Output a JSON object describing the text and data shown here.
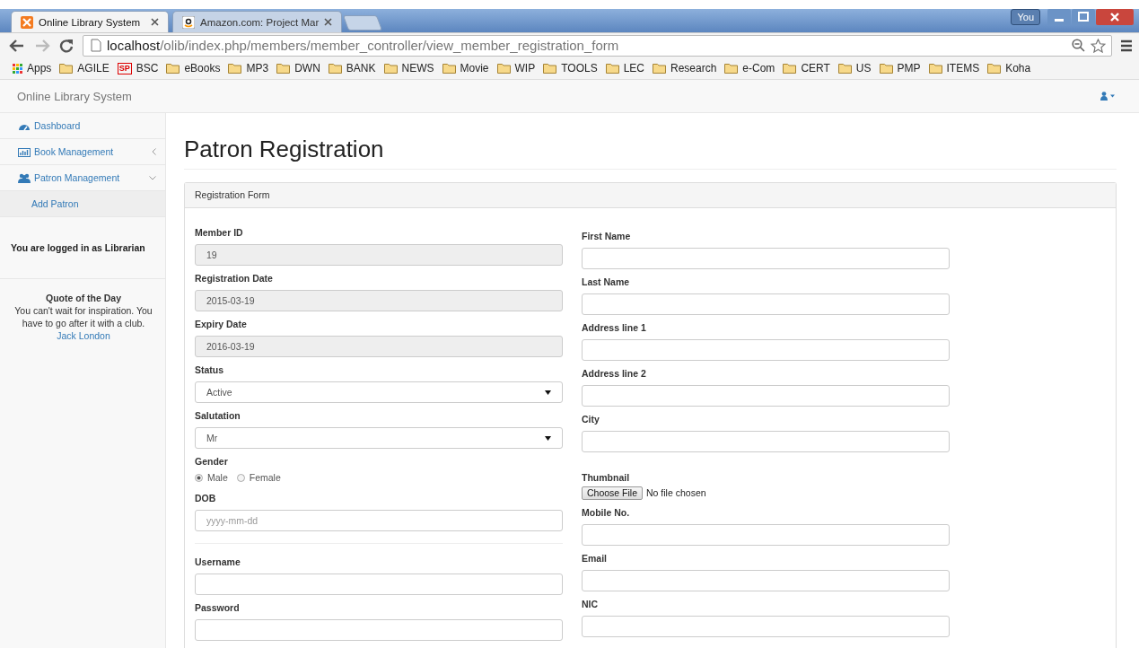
{
  "browser": {
    "tabs": [
      {
        "title": "Online Library System",
        "kind": "app",
        "selected": true
      },
      {
        "title": "Amazon.com: Project Mar",
        "kind": "shop",
        "selected": false
      }
    ],
    "user_badge": "You",
    "address": {
      "host": "localhost",
      "path": "/olib/index.php/members/member_controller/view_member_registration_form"
    },
    "bookmarks": [
      {
        "label": "Apps",
        "kind": "apps"
      },
      {
        "label": "AGILE",
        "kind": "folder"
      },
      {
        "label": "BSC",
        "kind": "sp",
        "badge": "SP"
      },
      {
        "label": "eBooks",
        "kind": "folder"
      },
      {
        "label": "MP3",
        "kind": "folder"
      },
      {
        "label": "DWN",
        "kind": "folder"
      },
      {
        "label": "BANK",
        "kind": "folder"
      },
      {
        "label": "NEWS",
        "kind": "folder"
      },
      {
        "label": "Movie",
        "kind": "folder"
      },
      {
        "label": "WIP",
        "kind": "folder"
      },
      {
        "label": "TOOLS",
        "kind": "folder"
      },
      {
        "label": "LEC",
        "kind": "folder"
      },
      {
        "label": "Research",
        "kind": "folder"
      },
      {
        "label": "e-Com",
        "kind": "folder"
      },
      {
        "label": "CERT",
        "kind": "folder"
      },
      {
        "label": "US",
        "kind": "folder"
      },
      {
        "label": "PMP",
        "kind": "folder"
      },
      {
        "label": "ITEMS",
        "kind": "folder"
      },
      {
        "label": "Koha",
        "kind": "folder"
      }
    ]
  },
  "app": {
    "brand": "Online Library System",
    "sidebar": {
      "items": [
        {
          "label": "Dashboard",
          "kind": "dashboard"
        },
        {
          "label": "Book Management",
          "kind": "chart",
          "expanded": false
        },
        {
          "label": "Patron Management",
          "kind": "users",
          "expanded": true,
          "children": [
            {
              "label": "Add Patron",
              "selected": true
            }
          ]
        }
      ],
      "login_text": "You are logged in as Librarian",
      "quote": {
        "heading": "Quote of the Day",
        "text": "You can't wait for inspiration. You have to go after it with a club.",
        "author": "Jack London"
      }
    },
    "page_title": "Patron Registration",
    "panel_heading": "Registration Form",
    "columns": [
      [
        {
          "kind": "text",
          "label": "Member ID",
          "value": "19",
          "disabled": true
        },
        {
          "kind": "text",
          "label": "Registration Date",
          "value": "2015-03-19",
          "disabled": true
        },
        {
          "kind": "text",
          "label": "Expiry Date",
          "value": "2016-03-19",
          "disabled": true
        },
        {
          "kind": "select",
          "label": "Status",
          "value": "Active"
        },
        {
          "kind": "select",
          "label": "Salutation",
          "value": "Mr"
        },
        {
          "kind": "radio",
          "label": "Gender",
          "options": [
            {
              "label": "Male",
              "selected": true
            },
            {
              "label": "Female",
              "selected": false
            }
          ]
        },
        {
          "kind": "text",
          "label": "DOB",
          "placeholder": "yyyy-mm-dd"
        },
        {
          "kind": "divider"
        },
        {
          "kind": "text",
          "label": "Username"
        },
        {
          "kind": "text",
          "label": "Password"
        }
      ],
      [
        {
          "kind": "text",
          "label": "First Name"
        },
        {
          "kind": "text",
          "label": "Last Name"
        },
        {
          "kind": "text",
          "label": "Address line 1"
        },
        {
          "kind": "text",
          "label": "Address line 2"
        },
        {
          "kind": "text",
          "label": "City"
        },
        {
          "kind": "file",
          "label": "Thumbnail",
          "button": "Choose File",
          "status": "No file chosen"
        },
        {
          "kind": "text",
          "label": "Mobile No."
        },
        {
          "kind": "text",
          "label": "Email"
        },
        {
          "kind": "text",
          "label": "NIC"
        }
      ]
    ]
  }
}
